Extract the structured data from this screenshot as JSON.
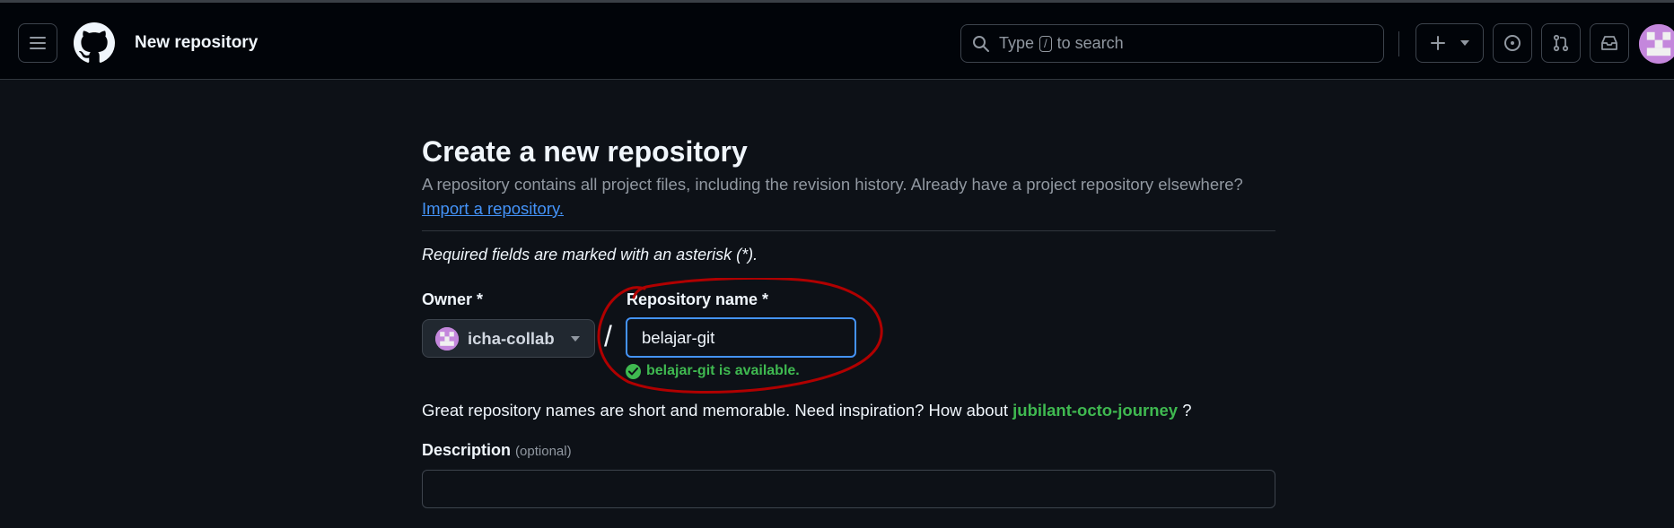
{
  "header": {
    "title": "New repository",
    "search_placeholder_pre": "Type",
    "search_key": "/",
    "search_placeholder_post": "to search"
  },
  "main": {
    "title": "Create a new repository",
    "lead": "A repository contains all project files, including the revision history. Already have a project repository elsewhere?",
    "import_link": "Import a repository.",
    "required_note": "Required fields are marked with an asterisk (*).",
    "owner_label": "Owner *",
    "owner_value": "icha-collab",
    "separator": "/",
    "repo_name_label": "Repository name *",
    "repo_name_value": "belajar-git",
    "availability": "belajar-git is available.",
    "suggestion_text": "Great repository names are short and memorable. Need inspiration? How about",
    "suggestion_name": "jubilant-octo-journey",
    "suggestion_end": "?",
    "description_label": "Description",
    "description_optional": "(optional)",
    "description_value": ""
  },
  "icons": [
    "hamburger-icon",
    "github-logo-icon",
    "search-icon",
    "plus-icon",
    "issues-icon",
    "pull-requests-icon",
    "inbox-icon",
    "check-circle-icon"
  ],
  "colors": {
    "background": "#0d1117",
    "accent": "#4493f8",
    "success": "#3fb950",
    "annotation": "#b00000"
  }
}
